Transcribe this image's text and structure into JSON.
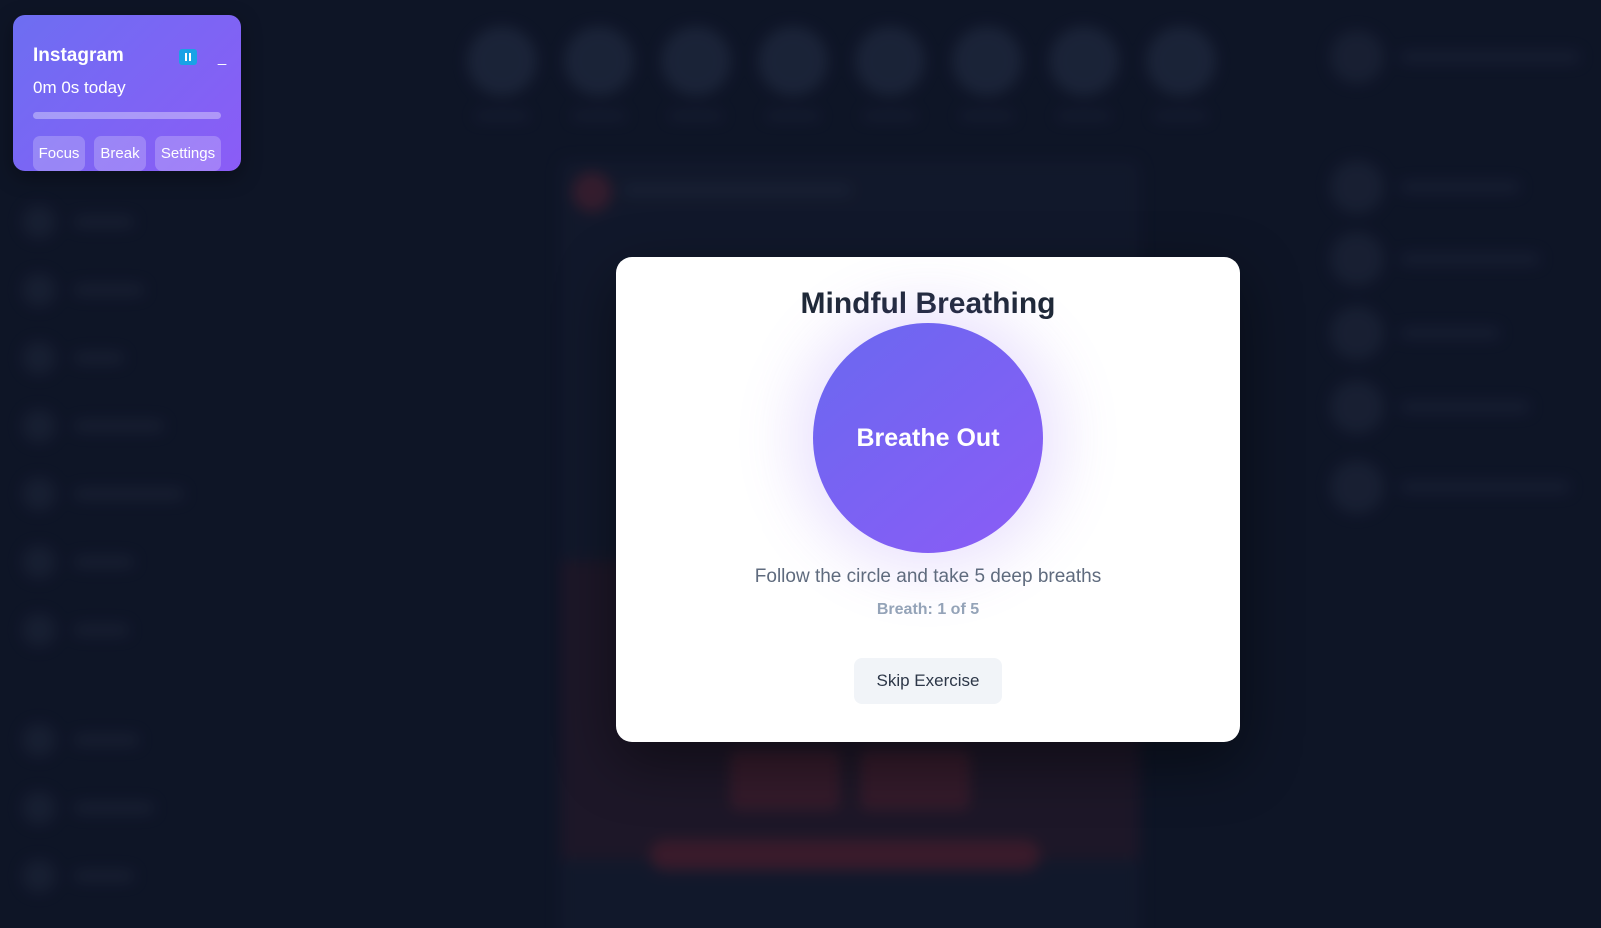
{
  "widget": {
    "app_name": "Instagram",
    "time_today": "0m 0s today",
    "progress_fraction": 0,
    "pause_icon": "pause-icon",
    "minimize_label": "_",
    "buttons": {
      "focus": "Focus",
      "break": "Break",
      "settings": "Settings"
    },
    "accent_color": "#7c6cf4",
    "pause_color": "#19a2e6"
  },
  "modal": {
    "title": "Mindful Breathing",
    "circle_text": "Breathe Out",
    "instruction": "Follow the circle and take 5 deep breaths",
    "counter": "Breath: 1 of 5",
    "skip_label": "Skip Exercise"
  },
  "colors": {
    "background": "#101729",
    "modal": "#ffffff",
    "circle_start": "#6a68f0",
    "circle_end": "#8b5cf6"
  }
}
